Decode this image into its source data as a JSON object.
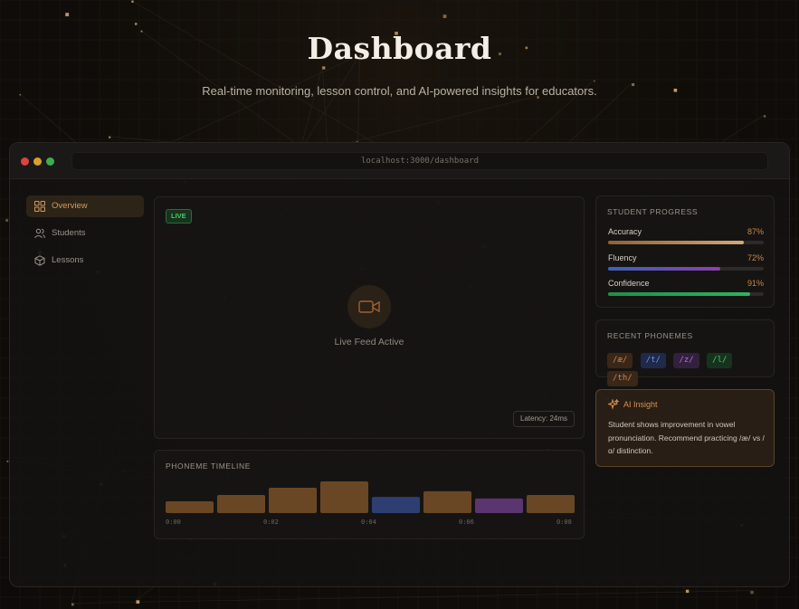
{
  "hero": {
    "title": "Dashboard",
    "subtitle": "Real-time monitoring, lesson control, and AI-powered insights for educators."
  },
  "window": {
    "url": "localhost:3000/dashboard"
  },
  "sidebar": {
    "items": [
      {
        "label": "Overview",
        "icon": "grid-icon",
        "active": true
      },
      {
        "label": "Students",
        "icon": "users-icon",
        "active": false
      },
      {
        "label": "Lessons",
        "icon": "box-icon",
        "active": false
      }
    ]
  },
  "video": {
    "live_badge": "LIVE",
    "status": "Live Feed Active",
    "latency": "Latency: 24ms"
  },
  "timeline": {
    "title": "PHONEME TIMELINE",
    "ticks": [
      "0:00",
      "0:02",
      "0:04",
      "0:06",
      "0:08"
    ],
    "segments": [
      {
        "level": 0.37,
        "color": "#6a4724"
      },
      {
        "level": 0.57,
        "color": "#6a4724"
      },
      {
        "level": 0.8,
        "color": "#6a4724"
      },
      {
        "level": 1.0,
        "color": "#6a4724"
      },
      {
        "level": 0.51,
        "color": "#2d3f72"
      },
      {
        "level": 0.69,
        "color": "#6a4724"
      },
      {
        "level": 0.46,
        "color": "#5a3570"
      },
      {
        "level": 0.57,
        "color": "#6a4724"
      }
    ]
  },
  "progress": {
    "title": "STUDENT PROGRESS",
    "metrics": [
      {
        "name": "Accuracy",
        "value": "87%",
        "fraction": 0.87,
        "gradient": [
          "#8c6236",
          "#d4a77a"
        ]
      },
      {
        "name": "Fluency",
        "value": "72%",
        "fraction": 0.72,
        "gradient": [
          "#3a62b8",
          "#8b3fb0"
        ]
      },
      {
        "name": "Confidence",
        "value": "91%",
        "fraction": 0.91,
        "gradient": [
          "#1f8f4a",
          "#2fb35e"
        ]
      }
    ]
  },
  "phonemes": {
    "title": "RECENT PHONEMES",
    "chips": [
      {
        "text": "/æ/",
        "bg": "#3a2718",
        "fg": "#c9874a"
      },
      {
        "text": "/t/",
        "bg": "#1f2a4a",
        "fg": "#6f8fe0"
      },
      {
        "text": "/z/",
        "bg": "#33203d",
        "fg": "#b36fd6"
      },
      {
        "text": "/l/",
        "bg": "#173320",
        "fg": "#4ec466"
      },
      {
        "text": "/th/",
        "bg": "#3a2718",
        "fg": "#c9874a"
      }
    ]
  },
  "insight": {
    "title": "AI Insight",
    "text": "Student shows improvement in vowel pronunciation. Recommend practicing /æ/ vs /ɑ/ distinction."
  },
  "colors": {
    "accent": "#c9874a",
    "live": "#4ec466"
  }
}
